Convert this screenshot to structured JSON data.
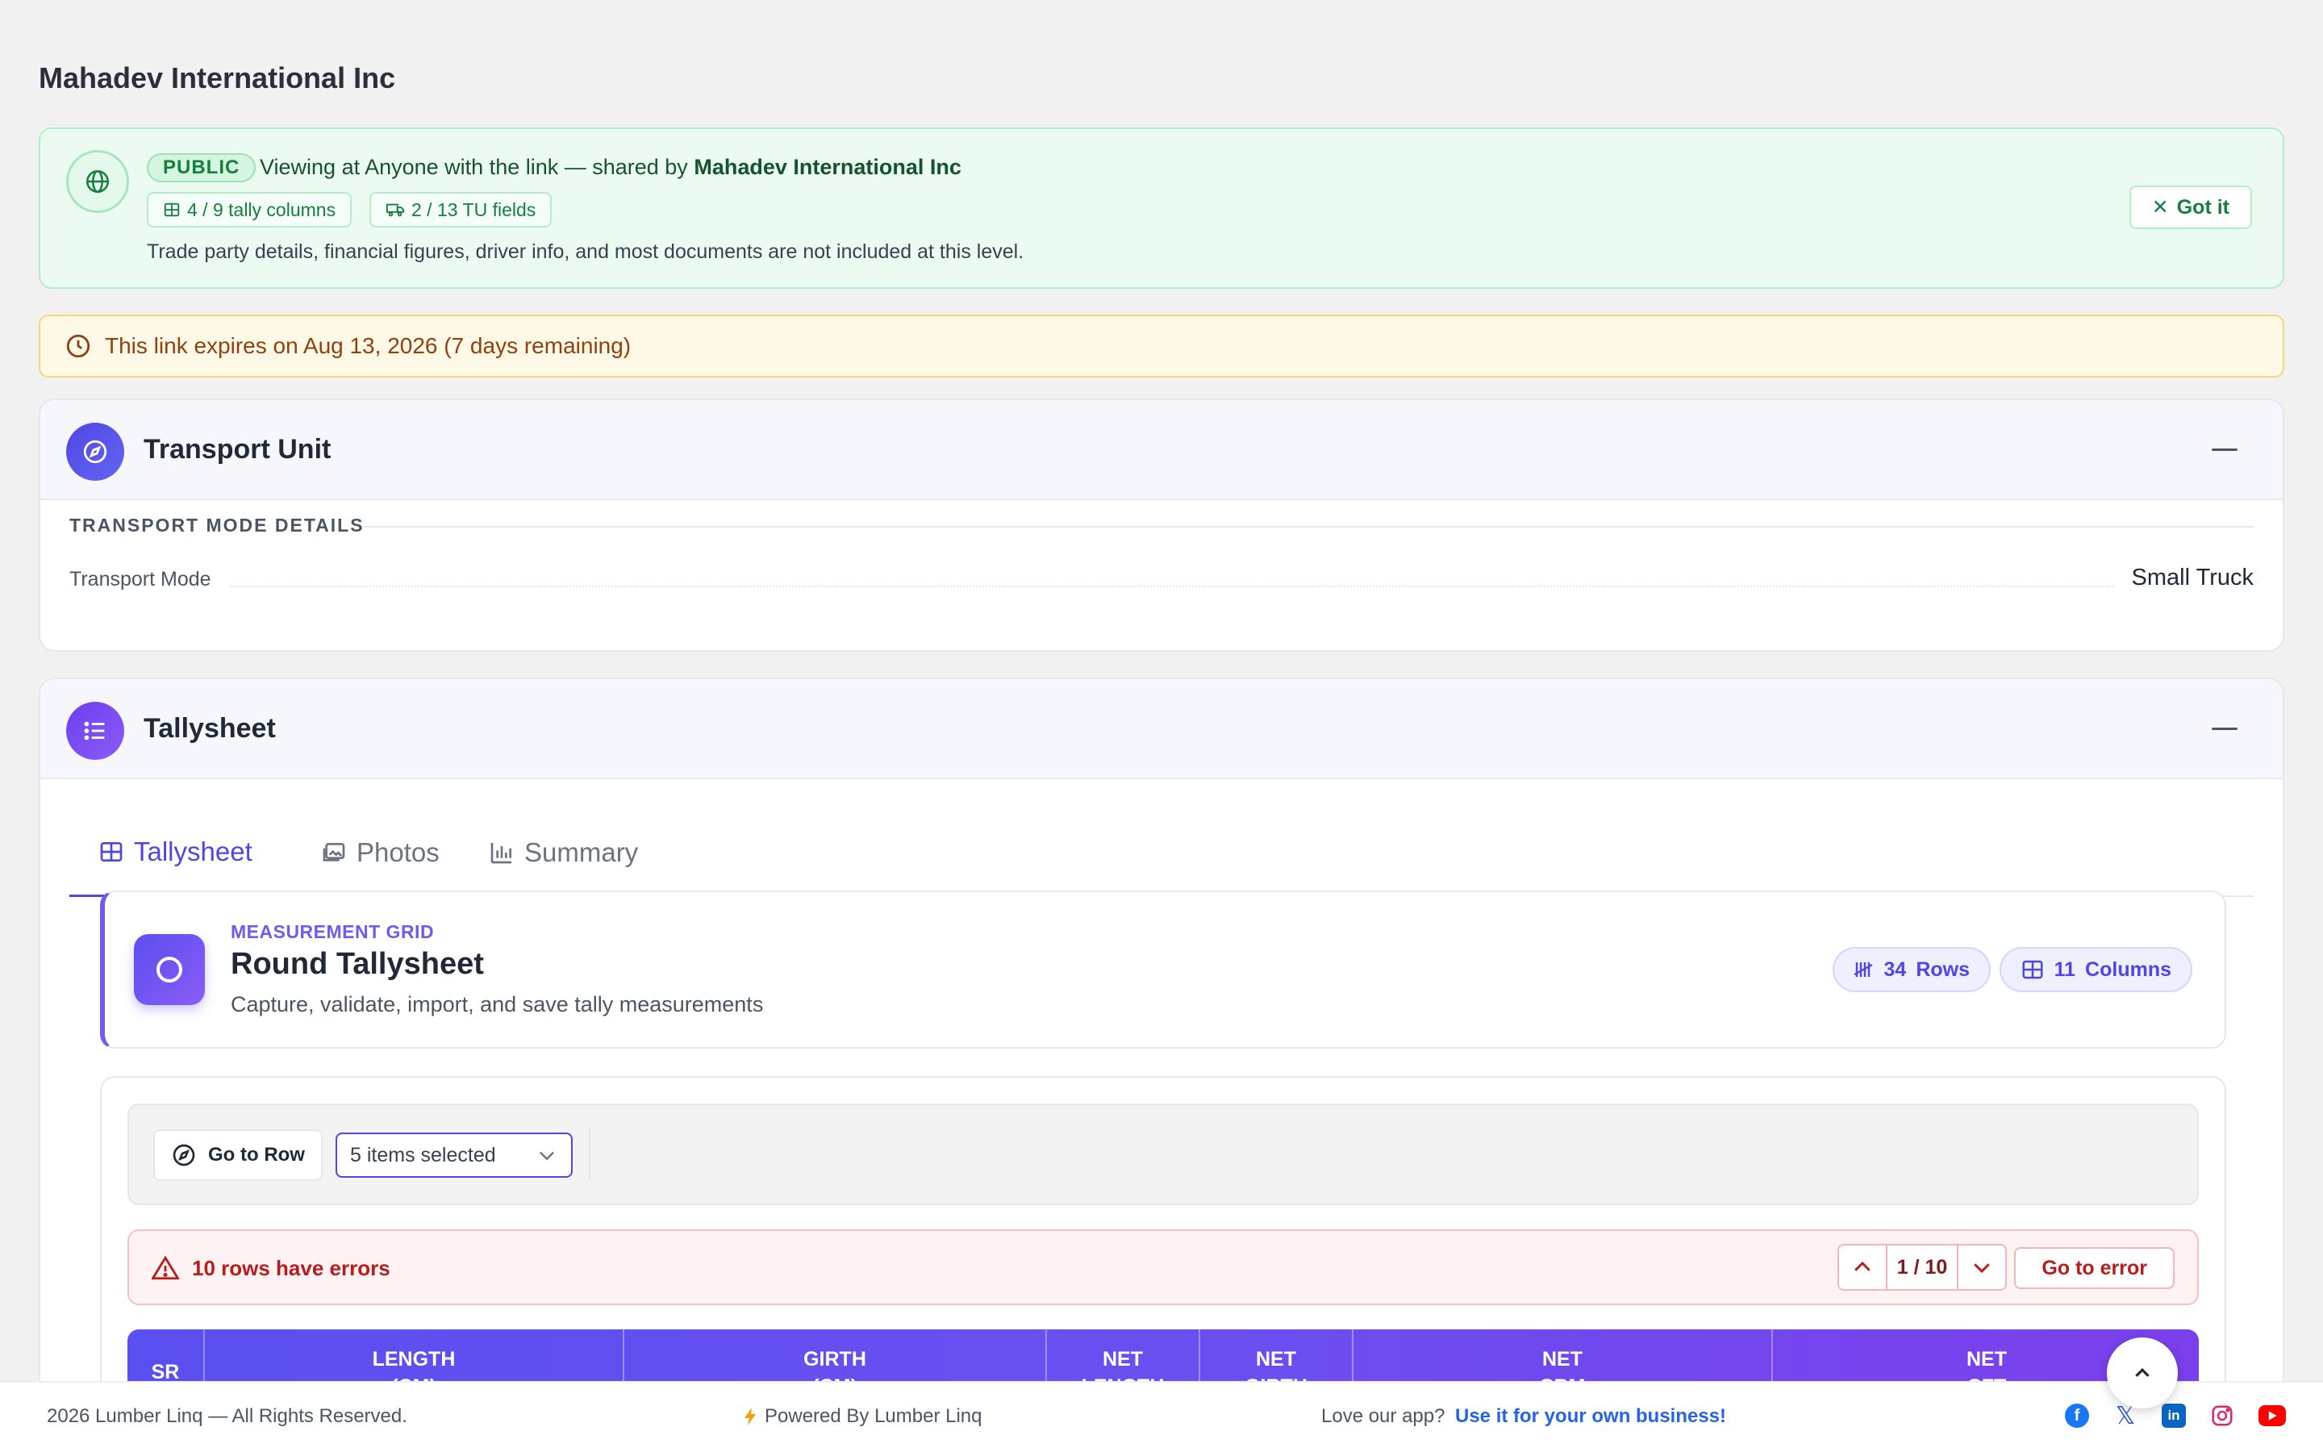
{
  "company": {
    "name": "Mahadev International Inc"
  },
  "public_banner": {
    "badge": "PUBLIC",
    "viewing_prefix": "Viewing at Anyone with the link — shared by",
    "shared_by": "Mahadev International Inc",
    "chip_tally": "4 / 9 tally columns",
    "chip_tu": "2 / 13 TU fields",
    "note": "Trade party details, financial figures, driver info, and most documents are not included at this level.",
    "got_it": "Got it"
  },
  "expiry": {
    "text": "This link expires on Aug 13, 2026 (7 days remaining)"
  },
  "transport_unit": {
    "title": "Transport Unit",
    "section_label": "TRANSPORT MODE DETAILS",
    "field_label": "Transport Mode",
    "field_value": "Small Truck"
  },
  "tallysheet": {
    "title": "Tallysheet",
    "tabs": [
      {
        "label": "Tallysheet",
        "active": true
      },
      {
        "label": "Photos",
        "active": false
      },
      {
        "label": "Summary",
        "active": false
      }
    ],
    "grid_card": {
      "kicker": "MEASUREMENT GRID",
      "title": "Round Tallysheet",
      "subtitle": "Capture, validate, import, and save tally measurements",
      "rows_count": "34",
      "rows_label": "Rows",
      "cols_count": "11",
      "cols_label": "Columns"
    },
    "toolbar": {
      "goto_row": "Go to Row",
      "select_value": "5 items selected"
    },
    "errors": {
      "text": "10 rows have errors",
      "position": "1 / 10",
      "go_to_error": "Go to error"
    },
    "columns": [
      {
        "line1": "SR",
        "line2": ""
      },
      {
        "line1": "LENGTH",
        "line2": "(CM)"
      },
      {
        "line1": "GIRTH",
        "line2": "(CM)"
      },
      {
        "line1": "NET",
        "line2": "LENGTH"
      },
      {
        "line1": "NET",
        "line2": "GIRTH"
      },
      {
        "line1": "NET",
        "line2": "CBM"
      },
      {
        "line1": "NET",
        "line2": "CFT"
      }
    ]
  },
  "footer": {
    "copyright": "2026 Lumber Linq — All Rights Reserved.",
    "powered": "Powered By Lumber Linq",
    "love": "Love our app?",
    "cta": "Use it for your own business!",
    "socials": [
      "facebook-icon",
      "x-icon",
      "linkedin-icon",
      "instagram-icon",
      "youtube-icon"
    ]
  },
  "colors": {
    "accent": "#4f46e5",
    "success": "#15803d",
    "warning": "#92400e",
    "error": "#b91c1c"
  }
}
